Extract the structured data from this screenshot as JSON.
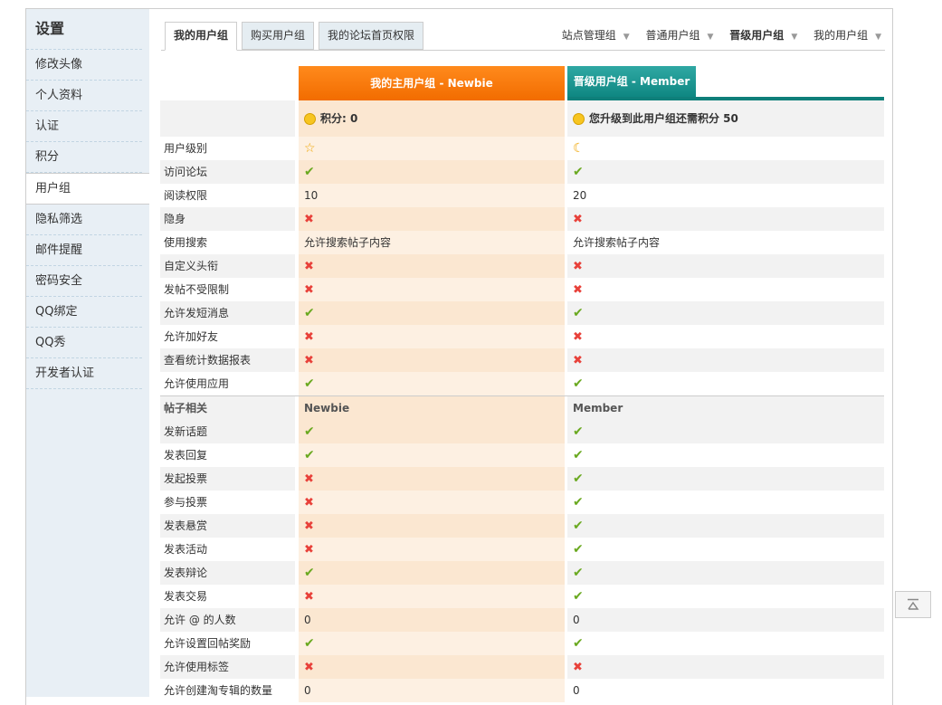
{
  "sidebar": {
    "title": "设置",
    "items": [
      {
        "label": "修改头像"
      },
      {
        "label": "个人资料"
      },
      {
        "label": "认证"
      },
      {
        "label": "积分"
      },
      {
        "label": "用户组"
      },
      {
        "label": "隐私筛选"
      },
      {
        "label": "邮件提醒"
      },
      {
        "label": "密码安全"
      },
      {
        "label": "QQ绑定"
      },
      {
        "label": "QQ秀"
      },
      {
        "label": "开发者认证"
      }
    ],
    "active_index": 4
  },
  "tabs": [
    {
      "label": "我的用户组"
    },
    {
      "label": "购买用户组"
    },
    {
      "label": "我的论坛首页权限"
    }
  ],
  "toplinks": [
    {
      "label": "站点管理组"
    },
    {
      "label": "普通用户组"
    },
    {
      "label": "晋级用户组"
    },
    {
      "label": "我的用户组"
    }
  ],
  "columns": {
    "main": "我的主用户组 - Newbie",
    "upgrade": "晋级用户组 - Member"
  },
  "score": {
    "main": "积分: 0",
    "upgrade": "您升级到此用户组还需积分 50"
  },
  "rows": [
    {
      "label": "用户级别",
      "main": "star",
      "up": "moon"
    },
    {
      "label": "访问论坛",
      "main": "yes",
      "up": "yes"
    },
    {
      "label": "阅读权限",
      "main": "10",
      "up": "20"
    },
    {
      "label": "隐身",
      "main": "no",
      "up": "no"
    },
    {
      "label": "使用搜索",
      "main": "允许搜索帖子内容",
      "up": "允许搜索帖子内容"
    },
    {
      "label": "自定义头衔",
      "main": "no",
      "up": "no"
    },
    {
      "label": "发帖不受限制",
      "main": "no",
      "up": "no"
    },
    {
      "label": "允许发短消息",
      "main": "yes",
      "up": "yes"
    },
    {
      "label": "允许加好友",
      "main": "no",
      "up": "no"
    },
    {
      "label": "查看统计数据报表",
      "main": "no",
      "up": "no"
    },
    {
      "label": "允许使用应用",
      "main": "yes",
      "up": "yes"
    }
  ],
  "section": {
    "label": "帖子相关",
    "main": "Newbie",
    "up": "Member"
  },
  "post_rows": [
    {
      "label": "发新话题",
      "main": "yes",
      "up": "yes"
    },
    {
      "label": "发表回复",
      "main": "yes",
      "up": "yes"
    },
    {
      "label": "发起投票",
      "main": "no",
      "up": "yes"
    },
    {
      "label": "参与投票",
      "main": "no",
      "up": "yes"
    },
    {
      "label": "发表悬赏",
      "main": "no",
      "up": "yes"
    },
    {
      "label": "发表活动",
      "main": "no",
      "up": "yes"
    },
    {
      "label": "发表辩论",
      "main": "yes",
      "up": "yes"
    },
    {
      "label": "发表交易",
      "main": "no",
      "up": "yes"
    },
    {
      "label": "允许 @ 的人数",
      "main": "0",
      "up": "0"
    },
    {
      "label": "允许设置回帖奖励",
      "main": "yes",
      "up": "yes"
    },
    {
      "label": "允许使用标签",
      "main": "no",
      "up": "no"
    },
    {
      "label": "允许创建淘专辑的数量",
      "main": "0",
      "up": "0"
    }
  ],
  "icons": {
    "yes": "check-icon",
    "no": "cross-icon",
    "star": "star-icon",
    "moon": "moon-icon",
    "bulb": "bulb-icon",
    "totop": "back-to-top-icon"
  },
  "colors": {
    "orange": "#f26c00",
    "teal": "#0f8782",
    "check": "#6aa920",
    "cross": "#e8413a"
  }
}
